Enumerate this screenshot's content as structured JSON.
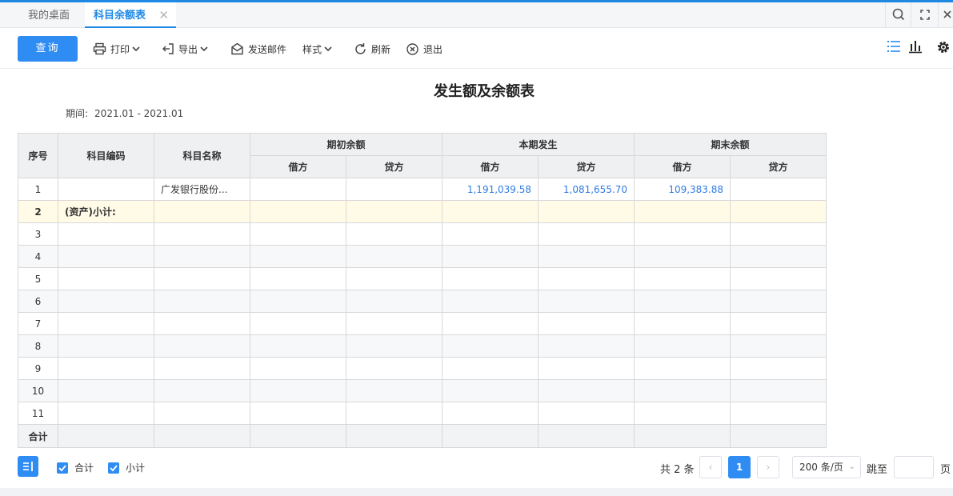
{
  "tabs": {
    "desktop": "我的桌面",
    "active": "科目余额表",
    "close_glyph": "✕"
  },
  "toolbar": {
    "query": "查询",
    "print": "打印",
    "export": "导出",
    "send_mail": "发送邮件",
    "style": "样式",
    "refresh": "刷新",
    "exit": "退出"
  },
  "report": {
    "title": "发生额及余额表",
    "period_label": "期间:",
    "period_value": "2021.01 - 2021.01"
  },
  "table": {
    "headers": {
      "index": "序号",
      "code": "科目编码",
      "name": "科目名称",
      "opening": "期初余额",
      "current": "本期发生",
      "closing": "期末余额",
      "debit": "借方",
      "credit": "贷方"
    },
    "rows": [
      {
        "idx": "1",
        "code": "",
        "name": "广发银行股份...",
        "open_debit": "",
        "open_credit": "",
        "cur_debit": "1,191,039.58",
        "cur_credit": "1,081,655.70",
        "close_debit": "109,383.88",
        "close_credit": ""
      },
      {
        "idx": "2",
        "code": "(资产)小计:",
        "name": "",
        "open_debit": "",
        "open_credit": "",
        "cur_debit": "",
        "cur_credit": "",
        "close_debit": "",
        "close_credit": ""
      },
      {
        "idx": "3",
        "code": "",
        "name": "",
        "open_debit": "",
        "open_credit": "",
        "cur_debit": "",
        "cur_credit": "",
        "close_debit": "",
        "close_credit": ""
      },
      {
        "idx": "4",
        "code": "",
        "name": "",
        "open_debit": "",
        "open_credit": "",
        "cur_debit": "",
        "cur_credit": "",
        "close_debit": "",
        "close_credit": ""
      },
      {
        "idx": "5",
        "code": "",
        "name": "",
        "open_debit": "",
        "open_credit": "",
        "cur_debit": "",
        "cur_credit": "",
        "close_debit": "",
        "close_credit": ""
      },
      {
        "idx": "6",
        "code": "",
        "name": "",
        "open_debit": "",
        "open_credit": "",
        "cur_debit": "",
        "cur_credit": "",
        "close_debit": "",
        "close_credit": ""
      },
      {
        "idx": "7",
        "code": "",
        "name": "",
        "open_debit": "",
        "open_credit": "",
        "cur_debit": "",
        "cur_credit": "",
        "close_debit": "",
        "close_credit": ""
      },
      {
        "idx": "8",
        "code": "",
        "name": "",
        "open_debit": "",
        "open_credit": "",
        "cur_debit": "",
        "cur_credit": "",
        "close_debit": "",
        "close_credit": ""
      },
      {
        "idx": "9",
        "code": "",
        "name": "",
        "open_debit": "",
        "open_credit": "",
        "cur_debit": "",
        "cur_credit": "",
        "close_debit": "",
        "close_credit": ""
      },
      {
        "idx": "10",
        "code": "",
        "name": "",
        "open_debit": "",
        "open_credit": "",
        "cur_debit": "",
        "cur_credit": "",
        "close_debit": "",
        "close_credit": ""
      },
      {
        "idx": "11",
        "code": "",
        "name": "",
        "open_debit": "",
        "open_credit": "",
        "cur_debit": "",
        "cur_credit": "",
        "close_debit": "",
        "close_credit": ""
      }
    ],
    "total_label": "合计"
  },
  "footer": {
    "chk_total": "合计",
    "chk_subtotal": "小计",
    "total_count": "共 2 条",
    "prev": "‹",
    "current_page": "1",
    "next": "›",
    "page_size": "200 条/页",
    "jump_label": "跳至",
    "page_unit": "页"
  },
  "colors": {
    "accent": "#2f8cf2",
    "number": "#2f7be5",
    "subtotal_row": "#fffbe6"
  }
}
